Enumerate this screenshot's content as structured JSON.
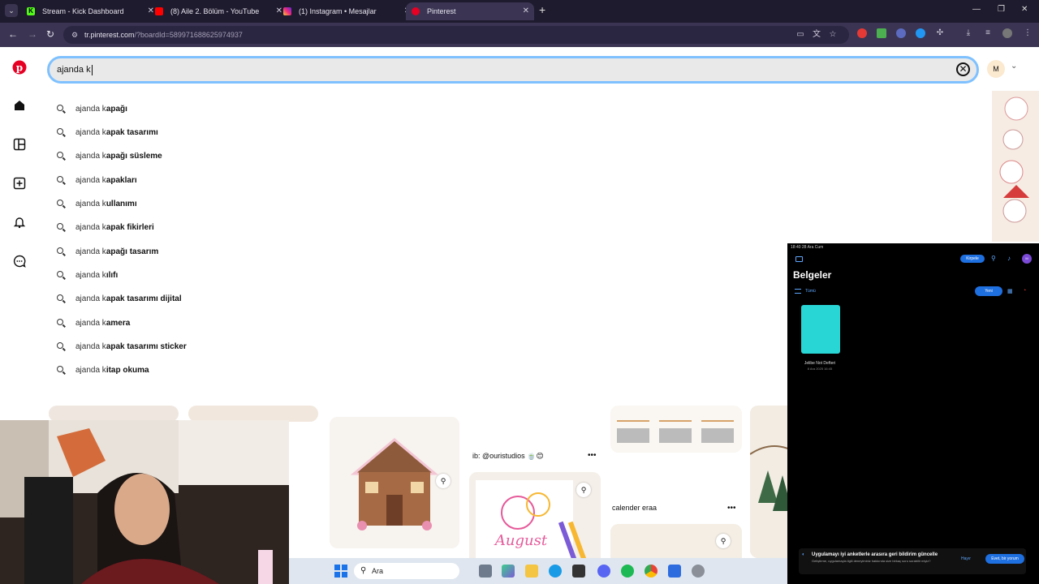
{
  "browser": {
    "tabs": [
      {
        "title": "Stream - Kick Dashboard",
        "favicon_color": "#53fc18",
        "favicon": "K"
      },
      {
        "title": "(8) Aile 2. Bölüm - YouTube",
        "favicon_color": "#ff0000",
        "favicon": "play-icon"
      },
      {
        "title": "(1) Instagram • Mesajlar",
        "favicon_color": "#d62976",
        "favicon": "instagram-icon"
      },
      {
        "title": "Pinterest",
        "favicon_color": "#e60023",
        "favicon": "pinterest-icon"
      }
    ],
    "active_tab_index": 3,
    "url_host": "tr.pinterest.com",
    "url_path": "/?boardId=589971688625974937"
  },
  "pinterest": {
    "avatar_initial": "M",
    "search": {
      "value": "ajanda k",
      "suggestion_prefix": "ajanda k",
      "suggestions": [
        "apağı",
        "apak tasarımı",
        "apağı süsleme",
        "apakları",
        "ullanımı",
        "apak fikirleri",
        "apağı tasarım",
        "ılıfı",
        "apak tasarımı dijital",
        "amera",
        "apak tasarımı sticker",
        "itap okuma"
      ]
    },
    "pins": {
      "caption_1": "ib: @ouristudios 🍵😊",
      "caption_2": "calender eraa"
    }
  },
  "tablet": {
    "status_time": "18:40  28 Ara Cum",
    "title": "Belgeler",
    "filter_label": "Tümü",
    "select_label": "Kirpele",
    "new_label": "Yeni",
    "notebook_name": "Jelibe Not Defteri",
    "notebook_date": "8 Ara 2025 16:45",
    "toast_title": "Uygulamayı iyi anketlerle arasıra geri bildirim güncelle",
    "toast_body": "Geliştirme, uygulamayla ilgili deneyiminiz hakkında size birkaç soru sorabilir miyiz?",
    "toast_no": "Hayır",
    "toast_yes": "Evet, bir yorum"
  },
  "taskbar": {
    "search_label": "Ara"
  }
}
